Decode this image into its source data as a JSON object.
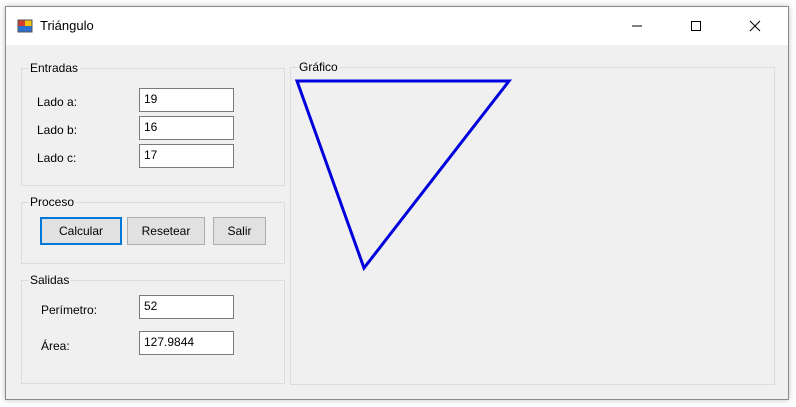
{
  "window": {
    "title": "Triángulo"
  },
  "entradas": {
    "title": "Entradas",
    "fields": [
      {
        "label": "Lado a:",
        "value": "19"
      },
      {
        "label": "Lado b:",
        "value": "16"
      },
      {
        "label": "Lado c:",
        "value": "17"
      }
    ]
  },
  "proceso": {
    "title": "Proceso",
    "buttons": {
      "calcular": "Calcular",
      "resetear": "Resetear",
      "salir": "Salir"
    }
  },
  "salidas": {
    "title": "Salidas",
    "perimetro_label": "Perímetro:",
    "perimetro_value": "52",
    "area_label": "Área:",
    "area_value": "127.9844"
  },
  "grafico": {
    "title": "Gráfico",
    "triangle_color": "#0000dd"
  },
  "colors": {
    "focus": "#0078d7",
    "window_bg": "#f0f0f0"
  },
  "icons": {
    "app": "triangle-app-icon",
    "minimize": "minimize-icon",
    "maximize": "maximize-icon",
    "close": "close-icon"
  }
}
